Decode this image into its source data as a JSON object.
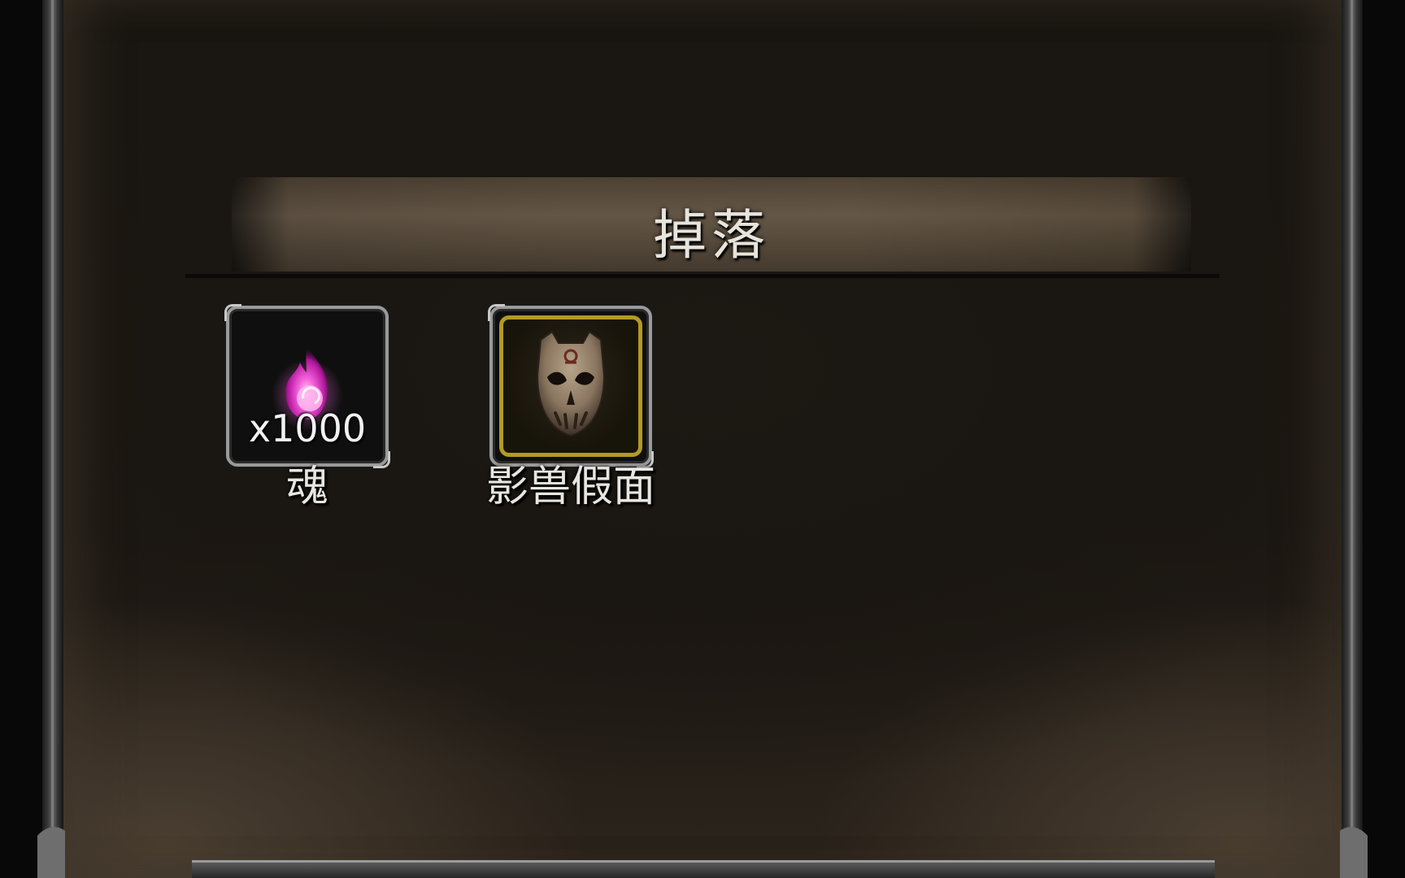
{
  "panel": {
    "title": "掉落"
  },
  "drops": [
    {
      "name": "魂",
      "count": "x1000",
      "icon": "soul-flame-icon",
      "color": "#e53bc9"
    },
    {
      "name": "影兽假面",
      "icon": "mask-icon",
      "border_color": "#b39a22"
    }
  ]
}
